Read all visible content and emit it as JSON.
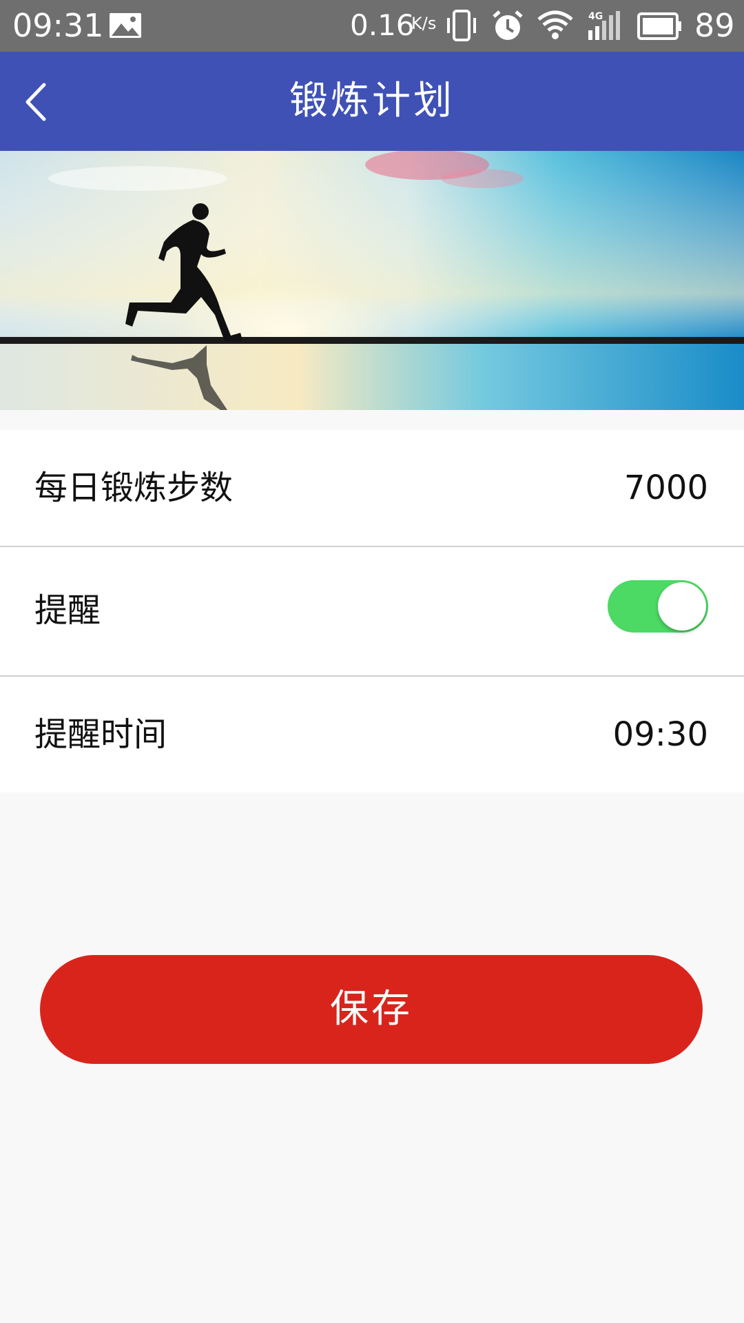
{
  "status_bar": {
    "time": "09:31",
    "network_speed": "0.16",
    "network_speed_unit": "K/s",
    "signal_type": "4G",
    "battery": "89",
    "icons": [
      "image-icon",
      "vibrate-icon",
      "alarm-icon",
      "wifi-icon",
      "signal-icon",
      "battery-icon"
    ]
  },
  "app_bar": {
    "title": "锻炼计划",
    "back_icon": "chevron-left-icon"
  },
  "banner": {
    "description_icon": "runner-silhouette-image"
  },
  "settings": {
    "daily_steps_label": "每日锻炼步数",
    "daily_steps_value": "7000",
    "reminder_label": "提醒",
    "reminder_on": true,
    "reminder_time_label": "提醒时间",
    "reminder_time_value": "09:30"
  },
  "actions": {
    "save_label": "保存"
  },
  "colors": {
    "status_bar": "#6f6f6f",
    "app_bar": "#3f51b5",
    "toggle_on": "#4cd964",
    "save_button": "#d9241c",
    "background": "#f8f8f8"
  }
}
